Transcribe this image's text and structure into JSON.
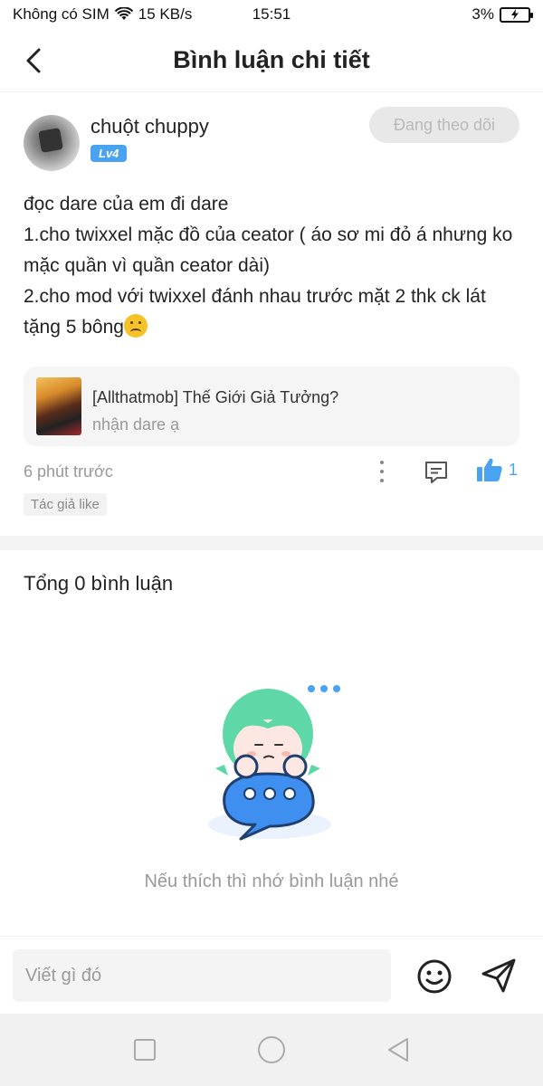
{
  "status_bar": {
    "carrier": "Không có SIM",
    "speed": "15 KB/s",
    "time": "15:51",
    "battery": "3%"
  },
  "header": {
    "title": "Bình luận chi tiết"
  },
  "post": {
    "author": "chuột chuppy",
    "level": "Lv4",
    "follow_label": "Đang theo dõi",
    "body_line1": "đọc dare của em đi dare",
    "body_line2": "1.cho twixxel mặc đồ của ceator ( áo sơ mi đỏ á nhưng ko mặc quần vì quần ceator dài)",
    "body_line3": "2.cho mod với twixxel đánh nhau trước mặt 2 thk ck lát tặng 5 bông",
    "emoji": "frowning-face",
    "linked_title": "[Allthatmob] Thế Giới Giả Tưởng?",
    "linked_subtitle": "nhận dare ạ",
    "time_ago": "6 phút trước",
    "like_count": "1",
    "author_like_badge": "Tác giả like"
  },
  "comments": {
    "total_label": "Tổng 0 bình luận",
    "empty_message": "Nếu thích thì nhớ bình luận nhé"
  },
  "input": {
    "placeholder": "Viết gì đó"
  },
  "colors": {
    "accent": "#4aa3f0",
    "mascot_hair": "#5dd8a6",
    "bubble": "#3f8ff0"
  }
}
